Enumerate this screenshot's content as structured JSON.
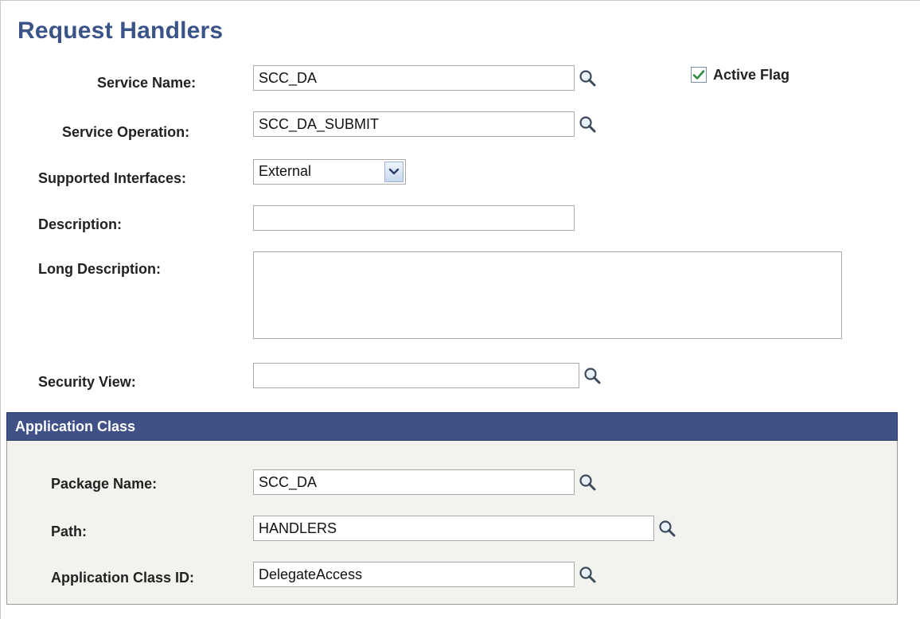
{
  "page": {
    "title": "Request Handlers"
  },
  "form": {
    "service_name": {
      "label": "Service Name:",
      "value": "SCC_DA"
    },
    "active_flag": {
      "label": "Active Flag",
      "checked": true
    },
    "service_operation": {
      "label": "Service Operation:",
      "value": "SCC_DA_SUBMIT"
    },
    "supported_interfaces": {
      "label": "Supported Interfaces:",
      "value": "External"
    },
    "description": {
      "label": "Description:",
      "value": ""
    },
    "long_description": {
      "label": "Long Description:",
      "value": ""
    },
    "security_view": {
      "label": "Security View:",
      "value": ""
    }
  },
  "application_class": {
    "header": "Application Class",
    "package_name": {
      "label": "Package Name:",
      "value": "SCC_DA"
    },
    "path": {
      "label": "Path:",
      "value": "HANDLERS"
    },
    "class_id": {
      "label": "Application Class ID:",
      "value": "DelegateAccess"
    }
  },
  "icons": {
    "lookup": "magnifier-icon",
    "dropdown": "chevron-down-icon",
    "check": "checkmark-icon"
  },
  "colors": {
    "title": "#3b5488",
    "section_header_bg": "#3f5186",
    "section_body_bg": "#f2f3ee"
  }
}
